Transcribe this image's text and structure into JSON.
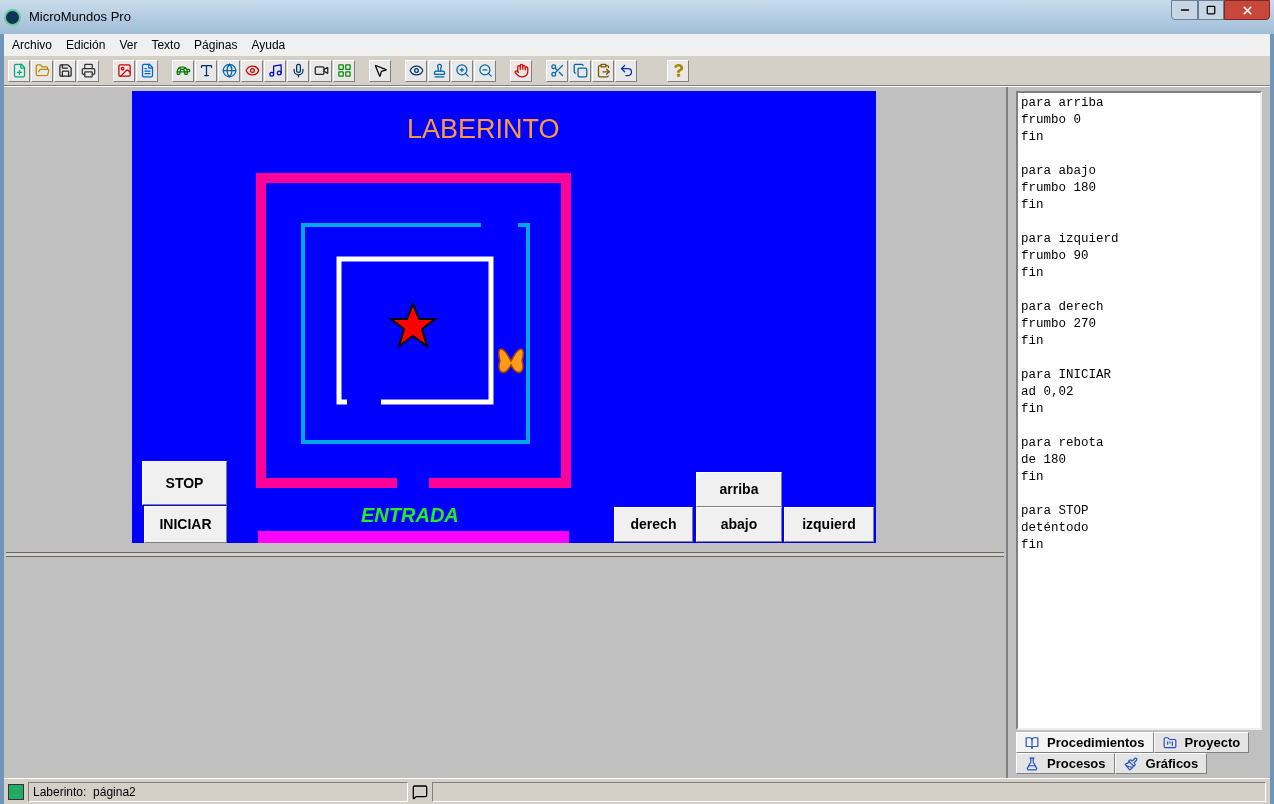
{
  "window": {
    "title": "MicroMundos Pro"
  },
  "menu": [
    "Archivo",
    "Edición",
    "Ver",
    "Texto",
    "Páginas",
    "Ayuda"
  ],
  "canvas": {
    "title": "LABERINTO",
    "entrance_label": "ENTRADA",
    "buttons": [
      {
        "label": "STOP",
        "kind": "left-top"
      },
      {
        "label": "arriba",
        "kind": "up"
      },
      {
        "label": "INICIAR",
        "kind": "left-bottom"
      },
      {
        "label": "derech",
        "kind": "right"
      },
      {
        "label": "abajo",
        "kind": "down"
      },
      {
        "label": "izquierd",
        "kind": "left"
      }
    ]
  },
  "procedures": [
    [
      "para arriba",
      "frumbo 0",
      "fin"
    ],
    [
      "para abajo",
      "frumbo 180",
      "fin"
    ],
    [
      "para izquierd",
      "frumbo 90",
      "fin"
    ],
    [
      "para derech",
      "frumbo 270",
      "fin"
    ],
    [
      "para INICIAR",
      "ad 0,02",
      "fin"
    ],
    [
      "para rebota",
      "de 180",
      "fin"
    ],
    [
      "para STOP",
      "deténtodo",
      "fin"
    ]
  ],
  "tab_rows": [
    [
      {
        "label": "Procedimientos",
        "selected": true
      },
      {
        "label": "Proyecto",
        "selected": false
      }
    ],
    [
      {
        "label": "Procesos",
        "selected": false
      },
      {
        "label": "Gráficos",
        "selected": false
      }
    ]
  ],
  "status_bar": {
    "text": "Laberinto:  página2"
  }
}
